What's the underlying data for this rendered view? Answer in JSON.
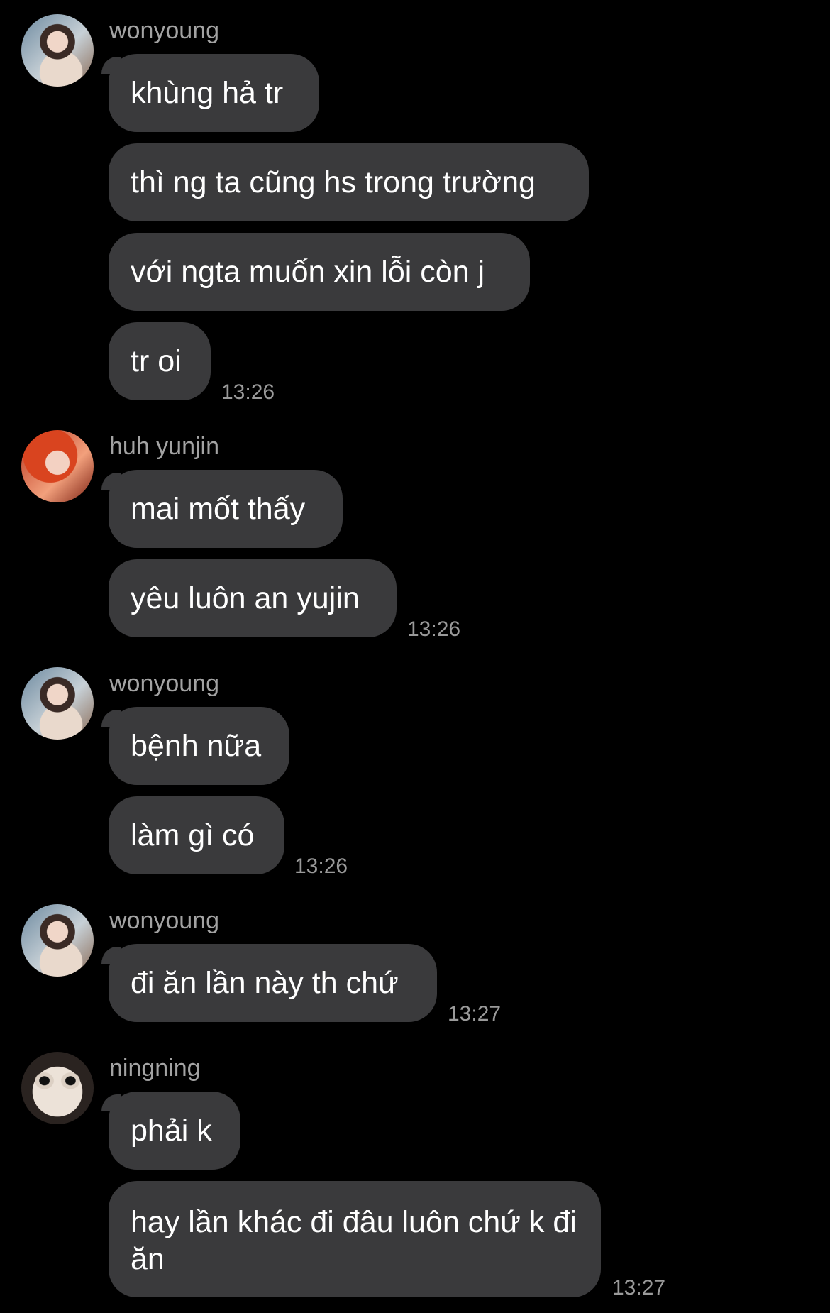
{
  "groups": [
    {
      "sender": "wonyoung",
      "avatar": "wonyoung-avatar",
      "messages": [
        "khùng hả tr",
        "thì ng ta cũng hs trong trường",
        "với ngta muốn xin lỗi còn j",
        "tr oi"
      ],
      "time": "13:26"
    },
    {
      "sender": "huh yunjin",
      "avatar": "yunjin-avatar",
      "messages": [
        "mai mốt thấy",
        "yêu luôn an yujin"
      ],
      "time": "13:26"
    },
    {
      "sender": "wonyoung",
      "avatar": "wonyoung-avatar",
      "messages": [
        "bệnh nữa",
        "làm gì có"
      ],
      "time": "13:26"
    },
    {
      "sender": "wonyoung",
      "avatar": "wonyoung-avatar",
      "messages": [
        "đi ăn lần này th chứ"
      ],
      "time": "13:27"
    },
    {
      "sender": "ningning",
      "avatar": "ningning-avatar",
      "messages": [
        "phải k",
        "hay lần khác đi đâu luôn chứ k đi ăn"
      ],
      "time": "13:27"
    }
  ],
  "colors": {
    "background": "#000000",
    "bubble": "#3a3a3c",
    "sender_text": "#a3a3a3",
    "time_text": "#9a9a9a"
  }
}
